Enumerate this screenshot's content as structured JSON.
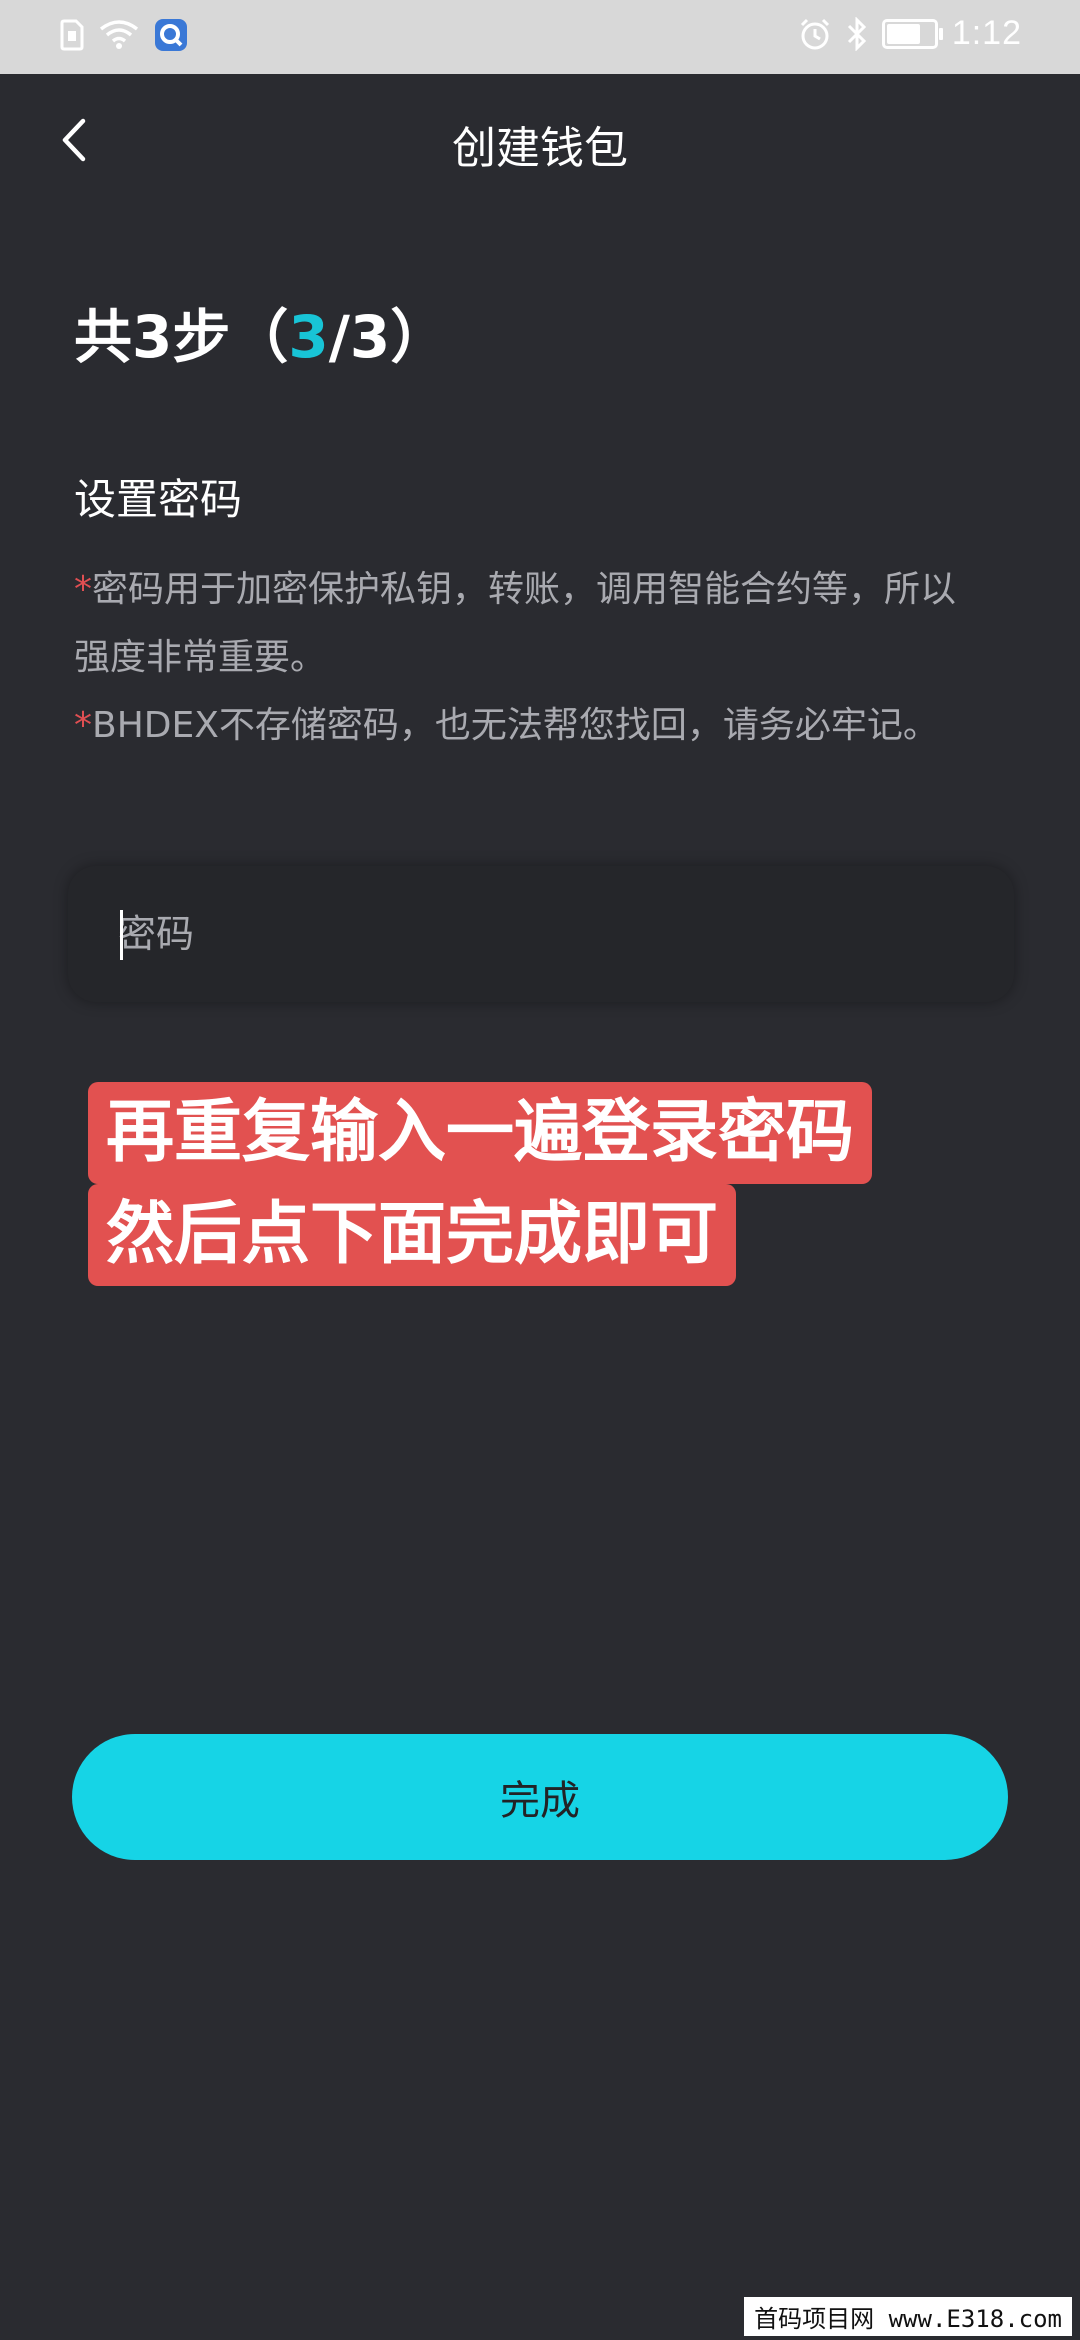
{
  "status_bar": {
    "time": "1:12",
    "battery_level": 0.75,
    "icons": [
      "sim-icon",
      "wifi-icon",
      "app-notification-icon",
      "alarm-icon",
      "bluetooth-icon",
      "battery-icon"
    ]
  },
  "header": {
    "title": "创建钱包",
    "back_icon": "chevron-left-icon"
  },
  "steps": {
    "prefix": "共3步（",
    "current": "3",
    "suffix": "/3）"
  },
  "section": {
    "title": "设置密码"
  },
  "notes": [
    {
      "marker": "*",
      "text": "密码用于加密保护私钥，转账，调用智能合约等，所以强度非常重要。"
    },
    {
      "marker": "*",
      "text": "BHDEX不存储密码，也无法帮您找回，请务必牢记。"
    }
  ],
  "password_field": {
    "placeholder": "密码",
    "value": ""
  },
  "overlay_caption": {
    "line1": "再重复输入一遍登录密码",
    "line2": "然后点下面完成即可"
  },
  "done_button": {
    "label": "完成"
  },
  "watermark": {
    "text": "首码项目网 www.E318.com"
  },
  "colors": {
    "background": "#2a2b30",
    "accent": "#16d4e6",
    "step_highlight": "#18c4d6",
    "asterisk": "#e04f52",
    "overlay": "#e25150"
  }
}
